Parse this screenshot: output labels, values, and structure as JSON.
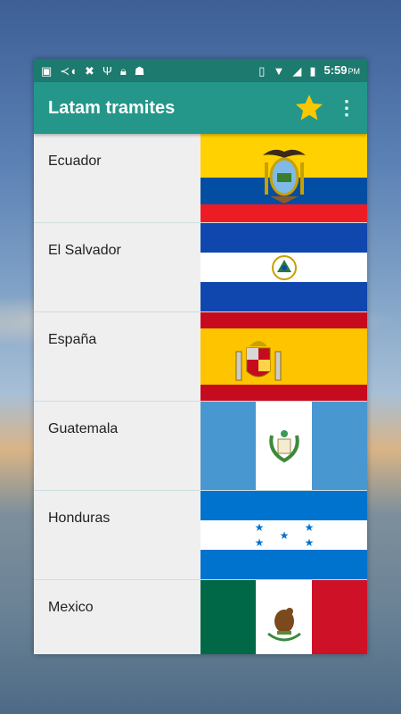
{
  "status_bar": {
    "left_icons": [
      "image-icon",
      "fish-icon",
      "cancel-shield-icon",
      "usb-icon",
      "lock-icon",
      "android-icon"
    ],
    "right_icons": [
      "vibrate-icon",
      "wifi-icon",
      "signal-icon",
      "battery-icon"
    ],
    "time": "5:59",
    "ampm": "PM"
  },
  "app_bar": {
    "title": "Latam tramites",
    "favorite_icon": "star-icon",
    "favorite_color": "#f9c800",
    "menu_icon": "more-vert-icon"
  },
  "colors": {
    "status_bar": "#1c7a6f",
    "app_bar": "#24978a",
    "list_background": "#efefef"
  },
  "countries": [
    {
      "name": "Ecuador",
      "flag": "ecuador-flag"
    },
    {
      "name": "El Salvador",
      "flag": "el-salvador-flag"
    },
    {
      "name": "España",
      "flag": "spain-flag"
    },
    {
      "name": "Guatemala",
      "flag": "guatemala-flag"
    },
    {
      "name": "Honduras",
      "flag": "honduras-flag"
    },
    {
      "name": "Mexico",
      "flag": "mexico-flag"
    }
  ]
}
